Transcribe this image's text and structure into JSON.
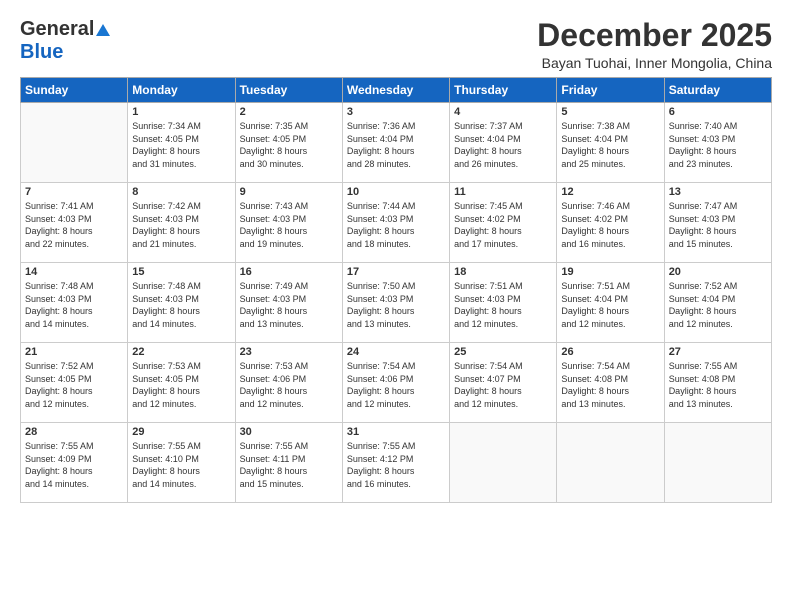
{
  "header": {
    "logo_general": "General",
    "logo_blue": "Blue",
    "month_title": "December 2025",
    "location": "Bayan Tuohai, Inner Mongolia, China"
  },
  "days_of_week": [
    "Sunday",
    "Monday",
    "Tuesday",
    "Wednesday",
    "Thursday",
    "Friday",
    "Saturday"
  ],
  "weeks": [
    [
      {
        "day": "",
        "info": ""
      },
      {
        "day": "1",
        "info": "Sunrise: 7:34 AM\nSunset: 4:05 PM\nDaylight: 8 hours\nand 31 minutes."
      },
      {
        "day": "2",
        "info": "Sunrise: 7:35 AM\nSunset: 4:05 PM\nDaylight: 8 hours\nand 30 minutes."
      },
      {
        "day": "3",
        "info": "Sunrise: 7:36 AM\nSunset: 4:04 PM\nDaylight: 8 hours\nand 28 minutes."
      },
      {
        "day": "4",
        "info": "Sunrise: 7:37 AM\nSunset: 4:04 PM\nDaylight: 8 hours\nand 26 minutes."
      },
      {
        "day": "5",
        "info": "Sunrise: 7:38 AM\nSunset: 4:04 PM\nDaylight: 8 hours\nand 25 minutes."
      },
      {
        "day": "6",
        "info": "Sunrise: 7:40 AM\nSunset: 4:03 PM\nDaylight: 8 hours\nand 23 minutes."
      }
    ],
    [
      {
        "day": "7",
        "info": "Sunrise: 7:41 AM\nSunset: 4:03 PM\nDaylight: 8 hours\nand 22 minutes."
      },
      {
        "day": "8",
        "info": "Sunrise: 7:42 AM\nSunset: 4:03 PM\nDaylight: 8 hours\nand 21 minutes."
      },
      {
        "day": "9",
        "info": "Sunrise: 7:43 AM\nSunset: 4:03 PM\nDaylight: 8 hours\nand 19 minutes."
      },
      {
        "day": "10",
        "info": "Sunrise: 7:44 AM\nSunset: 4:03 PM\nDaylight: 8 hours\nand 18 minutes."
      },
      {
        "day": "11",
        "info": "Sunrise: 7:45 AM\nSunset: 4:02 PM\nDaylight: 8 hours\nand 17 minutes."
      },
      {
        "day": "12",
        "info": "Sunrise: 7:46 AM\nSunset: 4:02 PM\nDaylight: 8 hours\nand 16 minutes."
      },
      {
        "day": "13",
        "info": "Sunrise: 7:47 AM\nSunset: 4:03 PM\nDaylight: 8 hours\nand 15 minutes."
      }
    ],
    [
      {
        "day": "14",
        "info": "Sunrise: 7:48 AM\nSunset: 4:03 PM\nDaylight: 8 hours\nand 14 minutes."
      },
      {
        "day": "15",
        "info": "Sunrise: 7:48 AM\nSunset: 4:03 PM\nDaylight: 8 hours\nand 14 minutes."
      },
      {
        "day": "16",
        "info": "Sunrise: 7:49 AM\nSunset: 4:03 PM\nDaylight: 8 hours\nand 13 minutes."
      },
      {
        "day": "17",
        "info": "Sunrise: 7:50 AM\nSunset: 4:03 PM\nDaylight: 8 hours\nand 13 minutes."
      },
      {
        "day": "18",
        "info": "Sunrise: 7:51 AM\nSunset: 4:03 PM\nDaylight: 8 hours\nand 12 minutes."
      },
      {
        "day": "19",
        "info": "Sunrise: 7:51 AM\nSunset: 4:04 PM\nDaylight: 8 hours\nand 12 minutes."
      },
      {
        "day": "20",
        "info": "Sunrise: 7:52 AM\nSunset: 4:04 PM\nDaylight: 8 hours\nand 12 minutes."
      }
    ],
    [
      {
        "day": "21",
        "info": "Sunrise: 7:52 AM\nSunset: 4:05 PM\nDaylight: 8 hours\nand 12 minutes."
      },
      {
        "day": "22",
        "info": "Sunrise: 7:53 AM\nSunset: 4:05 PM\nDaylight: 8 hours\nand 12 minutes."
      },
      {
        "day": "23",
        "info": "Sunrise: 7:53 AM\nSunset: 4:06 PM\nDaylight: 8 hours\nand 12 minutes."
      },
      {
        "day": "24",
        "info": "Sunrise: 7:54 AM\nSunset: 4:06 PM\nDaylight: 8 hours\nand 12 minutes."
      },
      {
        "day": "25",
        "info": "Sunrise: 7:54 AM\nSunset: 4:07 PM\nDaylight: 8 hours\nand 12 minutes."
      },
      {
        "day": "26",
        "info": "Sunrise: 7:54 AM\nSunset: 4:08 PM\nDaylight: 8 hours\nand 13 minutes."
      },
      {
        "day": "27",
        "info": "Sunrise: 7:55 AM\nSunset: 4:08 PM\nDaylight: 8 hours\nand 13 minutes."
      }
    ],
    [
      {
        "day": "28",
        "info": "Sunrise: 7:55 AM\nSunset: 4:09 PM\nDaylight: 8 hours\nand 14 minutes."
      },
      {
        "day": "29",
        "info": "Sunrise: 7:55 AM\nSunset: 4:10 PM\nDaylight: 8 hours\nand 14 minutes."
      },
      {
        "day": "30",
        "info": "Sunrise: 7:55 AM\nSunset: 4:11 PM\nDaylight: 8 hours\nand 15 minutes."
      },
      {
        "day": "31",
        "info": "Sunrise: 7:55 AM\nSunset: 4:12 PM\nDaylight: 8 hours\nand 16 minutes."
      },
      {
        "day": "",
        "info": ""
      },
      {
        "day": "",
        "info": ""
      },
      {
        "day": "",
        "info": ""
      }
    ]
  ]
}
